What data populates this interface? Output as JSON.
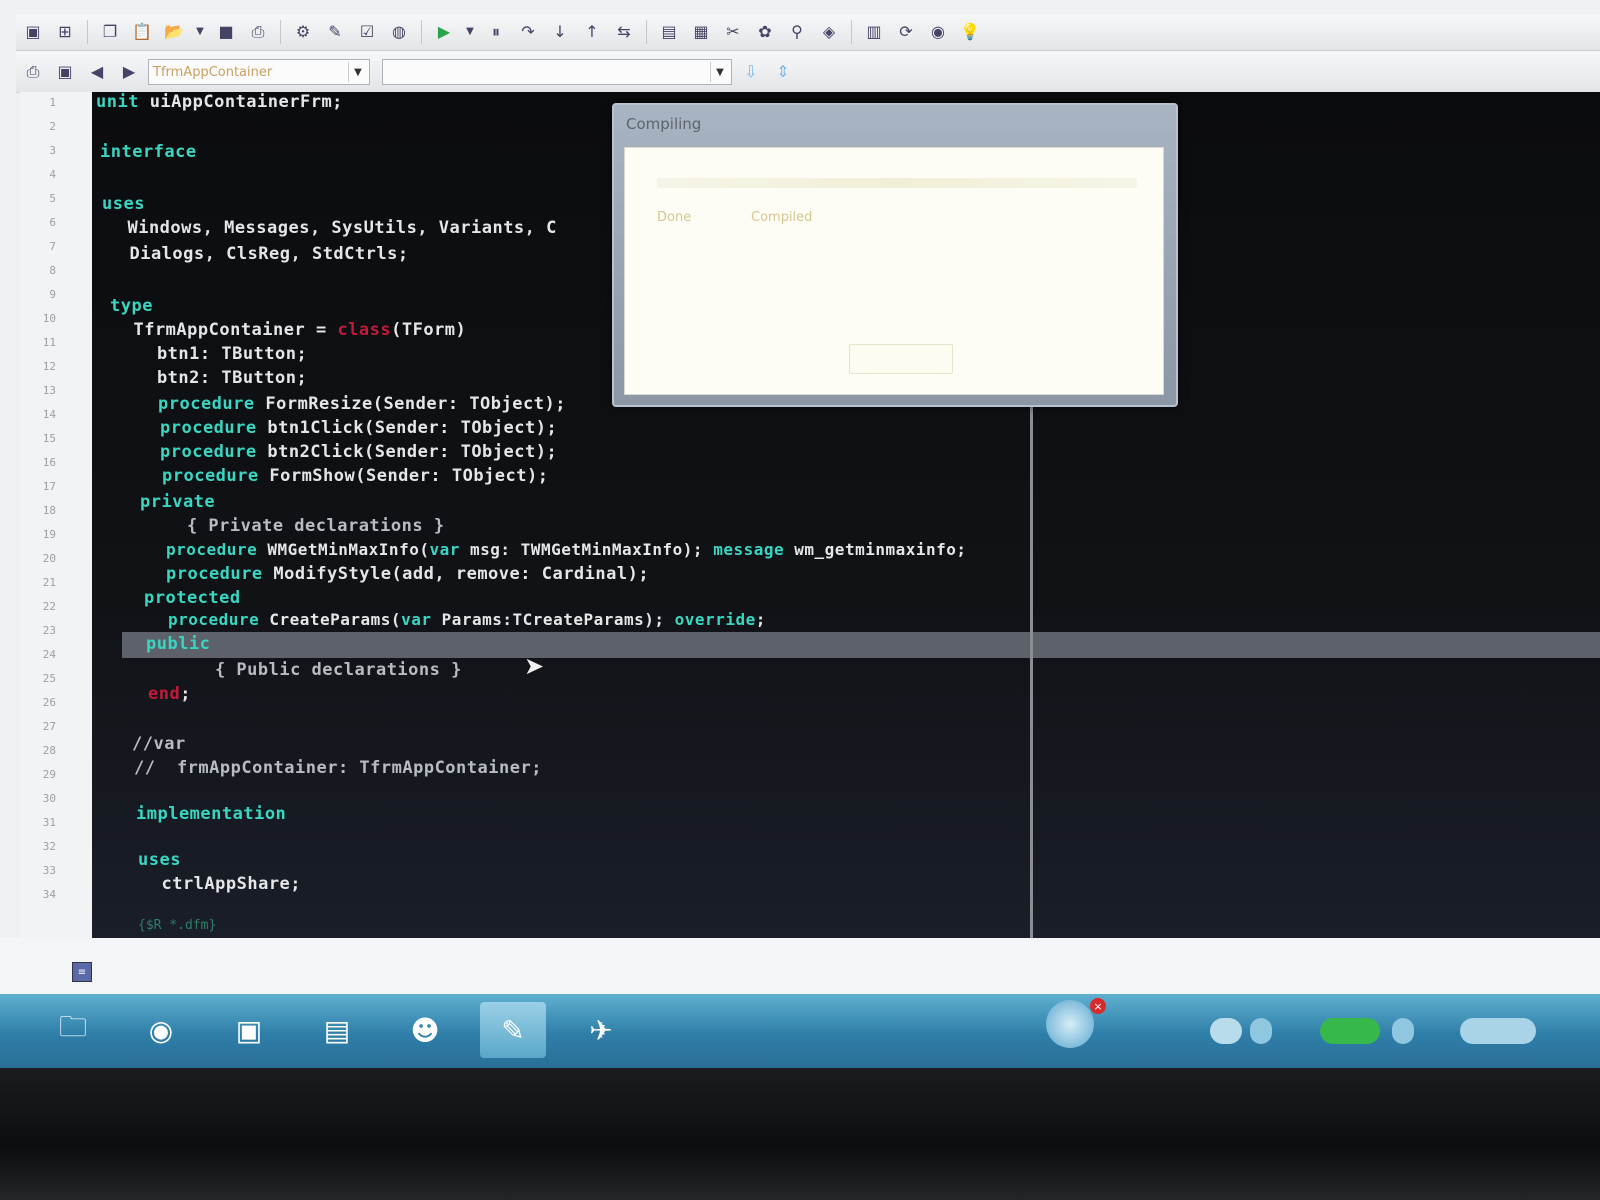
{
  "toolbar": {
    "row1_icons": [
      "save-all-icon",
      "open-project-icon",
      "copy-icon",
      "paste-icon",
      "folder-open-icon",
      "dropdown-arrow-icon",
      "stop-icon",
      "print-icon",
      "build-icon",
      "compile-icon",
      "check-icon",
      "globe-icon",
      "run-icon",
      "run-dropdown-icon",
      "pause-icon",
      "step-over-icon",
      "step-into-icon",
      "step-out-icon",
      "toggle-form-icon",
      "new-form-icon",
      "view-unit-icon",
      "tools-icon",
      "components-icon",
      "search-icon",
      "palette-icon",
      "help-book-icon",
      "refresh-icon",
      "globe2-icon",
      "bulb-icon"
    ],
    "row2_icons": [
      "print-preview-icon",
      "toggle-view-icon",
      "nav-back-icon",
      "nav-forward-icon"
    ],
    "class_combo_value": "TfrmAppContainer",
    "method_combo_value": "",
    "small_icons": [
      "bookmark-icon",
      "sync-icon"
    ]
  },
  "editor": {
    "line_numbers": [
      "1",
      "2",
      "3",
      "4",
      "5",
      "6",
      "7",
      "8",
      "9",
      "10",
      "11",
      "12",
      "13",
      "14",
      "15",
      "16",
      "17",
      "18",
      "19",
      "20",
      "21",
      "22",
      "23",
      "24",
      "25",
      "26",
      "27",
      "28",
      "29",
      "30",
      "31",
      "32",
      "33",
      "34"
    ],
    "lines": {
      "l1_kw": "unit",
      "l1_rest": " uiAppContainerFrm;",
      "l3_kw": "interface",
      "l5_kw": "uses",
      "l6": "  Windows, Messages, SysUtils, Variants, C",
      "l7": "  Dialogs, ClsReg, StdCtrls;",
      "l9_kw": "type",
      "l10_a": "  TfrmAppContainer = ",
      "l10_red": "class",
      "l10_b": "(TForm)",
      "l11": "    btn1: TButton;",
      "l12": "    btn2: TButton;",
      "l13_kw": "procedure",
      "l13_rest": " FormResize(Sender: TObject);",
      "l14_kw": "procedure",
      "l14_rest": " btn1Click(Sender: TObject);",
      "l15_kw": "procedure",
      "l15_rest": " btn2Click(Sender: TObject);",
      "l16_kw": "procedure",
      "l16_rest": " FormShow(Sender: TObject);",
      "l17_kw": "private",
      "l18": "    { Private declarations }",
      "l19_kw": "procedure",
      "l19_a": " WMGetMinMaxInfo(",
      "l19_kw2": "var",
      "l19_b": " msg: TWMGetMinMaxInfo); ",
      "l19_kw3": "message",
      "l19_c": " wm_getminmaxinfo;",
      "l20_kw": "procedure",
      "l20_a": " ModifyStyle(add, remove: Cardinal);",
      "l21_kw": "protected",
      "l22_kw": "procedure",
      "l22_a": " CreateParams(",
      "l22_kw2": "var",
      "l22_b": " Params:TCreateParams); ",
      "l22_kw3": "override",
      "l22_c": ";",
      "l23_kw": "public",
      "l24": "    { Public declarations }",
      "l25_red": "end",
      "l25_rest": ";",
      "l27": "//var",
      "l28": "//  frmAppContainer: TfrmAppContainer;",
      "l30_kw": "implementation",
      "l32_kw": "uses",
      "l33": "  ctrlAppShare;",
      "l35": "{$R *.dfm}"
    }
  },
  "dialog": {
    "title": "Compiling",
    "done_label": "Done",
    "status_value": "Compiled"
  },
  "taskbar": {
    "items": [
      "folder-icon",
      "media-player-icon",
      "delphi-ide-icon",
      "document-icon",
      "user-icon",
      "paint-icon",
      "tools-icon"
    ],
    "tray_icons": [
      "network-icon",
      "volume-icon",
      "battery-icon",
      "flag-icon"
    ]
  }
}
